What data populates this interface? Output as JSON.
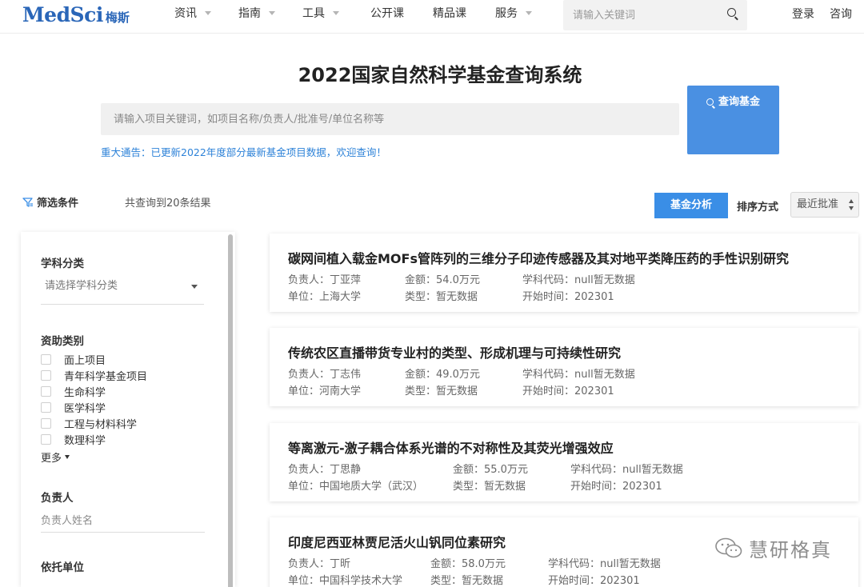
{
  "brand": {
    "name_en": "MedSci",
    "name_cn": "梅斯"
  },
  "nav": {
    "items": [
      {
        "label": "资讯",
        "has_caret": true
      },
      {
        "label": "指南",
        "has_caret": true
      },
      {
        "label": "工具",
        "has_caret": true
      },
      {
        "label": "公开课",
        "has_caret": false
      },
      {
        "label": "精品课",
        "has_caret": false
      },
      {
        "label": "服务",
        "has_caret": true
      }
    ],
    "search_placeholder": "请输入关键词",
    "login": "登录",
    "consult": "咨询"
  },
  "hero": {
    "title": "2022国家自然科学基金查询系统",
    "search_placeholder": "请输入项目关键词，如项目名称/负责人/批准号/单位名称等",
    "search_button": "查询基金",
    "notice": "重大通告：已更新2022年度部分最新基金项目数据，欢迎查询！"
  },
  "toolbar": {
    "filter_label": "筛选条件",
    "result_count": "共查询到20条结果",
    "analysis_button": "基金分析",
    "sort_label": "排序方式",
    "sort_value": "最近批准"
  },
  "sidebar": {
    "subject_title": "学科分类",
    "subject_placeholder": "请选择学科分类",
    "funding_title": "资助类别",
    "funding_options": [
      "面上项目",
      "青年科学基金项目",
      "生命科学",
      "医学科学",
      "工程与材料科学",
      "数理科学"
    ],
    "more_label": "更多",
    "leader_title": "负责人",
    "leader_placeholder": "负责人姓名",
    "unit_title": "依托单位"
  },
  "results": [
    {
      "title": "碳网间植入载金MOFs管阵列的三维分子印迹传感器及其对地平类降压药的手性识别研究",
      "leader": "负责人：丁亚萍",
      "amount": "金额：54.0万元",
      "code": "学科代码：null暂无数据",
      "unit": "单位：上海大学",
      "type": "类型：暂无数据",
      "start": "开始时间：202301"
    },
    {
      "title": "传统农区直播带货专业村的类型、形成机理与可持续性研究",
      "leader": "负责人：丁志伟",
      "amount": "金额：49.0万元",
      "code": "学科代码：null暂无数据",
      "unit": "单位：河南大学",
      "type": "类型：暂无数据",
      "start": "开始时间：202301"
    },
    {
      "title": "等离激元-激子耦合体系光谱的不对称性及其荧光增强效应",
      "leader": "负责人：丁思静",
      "amount": "金额：55.0万元",
      "code": "学科代码：null暂无数据",
      "unit": "单位：中国地质大学（武汉）",
      "type": "类型：暂无数据",
      "start": "开始时间：202301"
    },
    {
      "title": "印度尼西亚林贾尼活火山钒同位素研究",
      "leader": "负责人：丁昕",
      "amount": "金额：58.0万元",
      "code": "学科代码：null暂无数据",
      "unit": "单位：中国科学技术大学",
      "type": "类型：暂无数据",
      "start": "开始时间：202301"
    }
  ],
  "watermark": "慧研格真",
  "colors": {
    "brand": "#2a66b8",
    "accent": "#4a90e2",
    "notice": "#2d82d8"
  }
}
